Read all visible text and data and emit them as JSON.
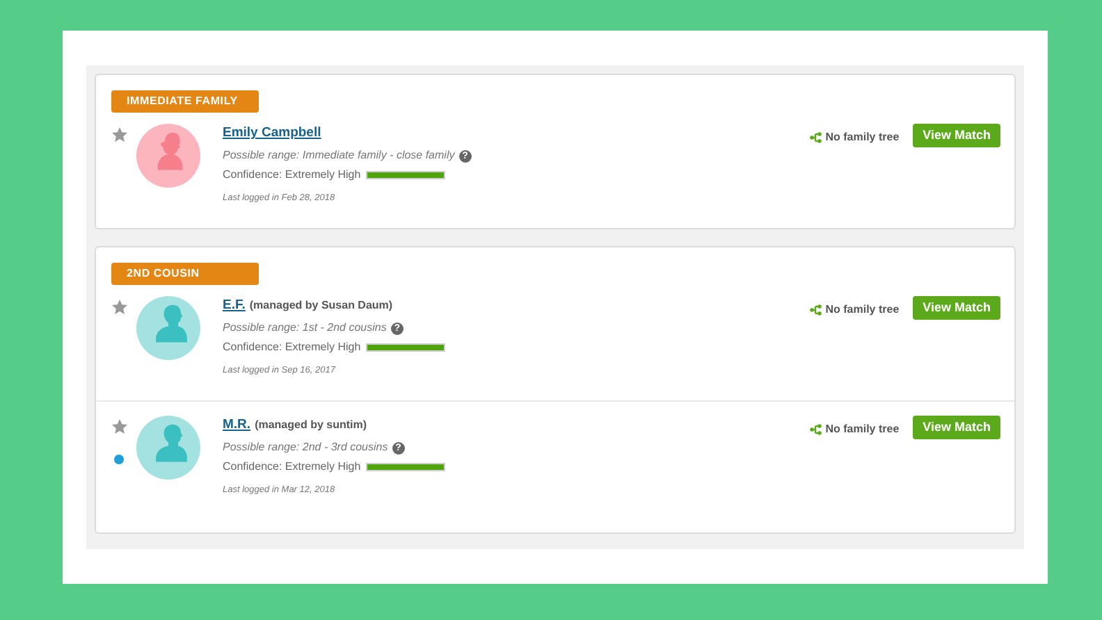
{
  "groups": [
    {
      "label": "IMMEDIATE FAMILY",
      "matches": [
        {
          "name": "Emily Campbell",
          "kind": "female",
          "starred": false,
          "new": false,
          "range": "Possible range: Immediate family - close family",
          "help": "?",
          "confidence": "Confidence: Extremely High",
          "level": 1,
          "last_logged": "Last logged in Feb 28, 2018",
          "tree": "No family tree",
          "button": "View Match"
        }
      ]
    },
    {
      "label": "2ND COUSIN",
      "matches": [
        {
          "name": "E.F.",
          "managed_by": "(managed by Susan Daum)",
          "kind": "male",
          "starred": false,
          "new": false,
          "range": "Possible range: 1st - 2nd cousins",
          "help": "?",
          "confidence": "Confidence: Extremely High",
          "level": 1,
          "last_logged": "Last logged in Sep 16, 2017",
          "tree": "No family tree",
          "button": "View Match"
        },
        {
          "name": "M.R.",
          "managed_by": "(managed by suntim)",
          "kind": "male",
          "starred": false,
          "new": true,
          "range": "Possible range: 2nd - 3rd cousins",
          "help": "?",
          "confidence": "Confidence: Extremely High",
          "level": 1,
          "last_logged": "Last logged in Mar 12, 2018",
          "tree": "No family tree",
          "button": "View Match"
        }
      ]
    }
  ]
}
